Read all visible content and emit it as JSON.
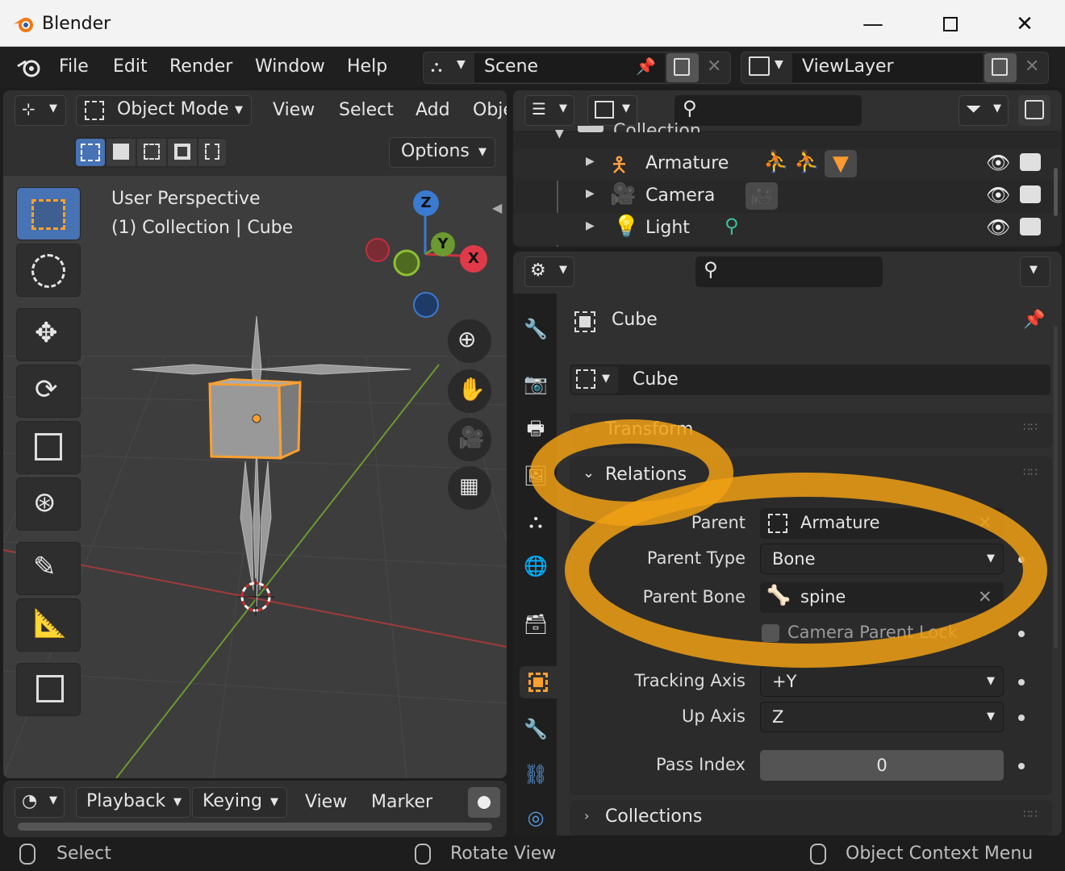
{
  "window": {
    "title": "Blender"
  },
  "menubar": {
    "items": [
      "File",
      "Edit",
      "Render",
      "Window",
      "Help"
    ],
    "scene_name": "Scene",
    "view_layer_name": "ViewLayer"
  },
  "viewport": {
    "mode": "Object Mode",
    "menus": [
      "View",
      "Select",
      "Add",
      "Obje"
    ],
    "options_label": "Options",
    "perspective_label": "User Perspective",
    "context_label": "(1) Collection | Cube",
    "gizmo": {
      "x": "X",
      "y": "Y",
      "z": "Z"
    }
  },
  "timeline": {
    "menus": [
      "Playback",
      "Keying",
      "View",
      "Marker"
    ]
  },
  "outliner": {
    "collection_label": "Collection",
    "items": [
      {
        "name": "Armature"
      },
      {
        "name": "Camera"
      },
      {
        "name": "Light"
      }
    ]
  },
  "properties": {
    "object_name": "Cube",
    "object_datablock": "Cube",
    "sections": {
      "transform": "Transform",
      "relations": "Relations",
      "collections": "Collections"
    },
    "relations": {
      "parent_label": "Parent",
      "parent_value": "Armature",
      "parent_type_label": "Parent Type",
      "parent_type_value": "Bone",
      "parent_bone_label": "Parent Bone",
      "parent_bone_value": "spine",
      "camera_parent_lock_label": "Camera Parent Lock",
      "tracking_axis_label": "Tracking Axis",
      "tracking_axis_value": "+Y",
      "up_axis_label": "Up Axis",
      "up_axis_value": "Z",
      "pass_index_label": "Pass Index",
      "pass_index_value": "0"
    }
  },
  "statusbar": {
    "left": "Select",
    "middle": "Rotate View",
    "right": "Object Context Menu"
  },
  "colors": {
    "accent_blue": "#4772b3",
    "highlight_orange": "#f0a014",
    "selection_orange": "#ffa030"
  }
}
